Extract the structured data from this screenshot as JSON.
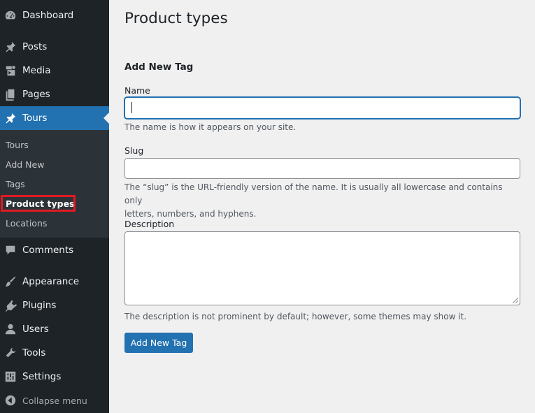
{
  "sidebar": {
    "items": [
      {
        "label": "Dashboard",
        "icon": "dashboard-icon"
      },
      {
        "label": "Posts",
        "icon": "pin-icon"
      },
      {
        "label": "Media",
        "icon": "media-icon"
      },
      {
        "label": "Pages",
        "icon": "pages-icon"
      },
      {
        "label": "Tours",
        "icon": "pin-icon",
        "current": true
      },
      {
        "label": "Comments",
        "icon": "comment-icon"
      },
      {
        "label": "Appearance",
        "icon": "brush-icon"
      },
      {
        "label": "Plugins",
        "icon": "plugin-icon"
      },
      {
        "label": "Users",
        "icon": "user-icon"
      },
      {
        "label": "Tools",
        "icon": "wrench-icon"
      },
      {
        "label": "Settings",
        "icon": "settings-icon"
      }
    ],
    "submenu": [
      "Tours",
      "Add New",
      "Tags",
      "Product types",
      "Locations"
    ],
    "active_submenu": "Product types",
    "collapse_label": "Collapse menu"
  },
  "main": {
    "title": "Product types",
    "form_heading": "Add New Tag",
    "name_label": "Name",
    "name_value": "",
    "name_help": "The name is how it appears on your site.",
    "slug_label": "Slug",
    "slug_value": "",
    "slug_help_line1": "The “slug” is the URL-friendly version of the name. It is usually all lowercase and contains only",
    "slug_help_line2": "letters, numbers, and hyphens.",
    "description_label": "Description",
    "description_value": "",
    "description_help": "The description is not prominent by default; however, some themes may show it.",
    "submit_label": "Add New Tag"
  },
  "colors": {
    "sidebar_bg": "#1d2327",
    "submenu_bg": "#2c3338",
    "accent": "#2271b1",
    "highlight_box": "#e01a22",
    "page_bg": "#f0f0f1"
  }
}
